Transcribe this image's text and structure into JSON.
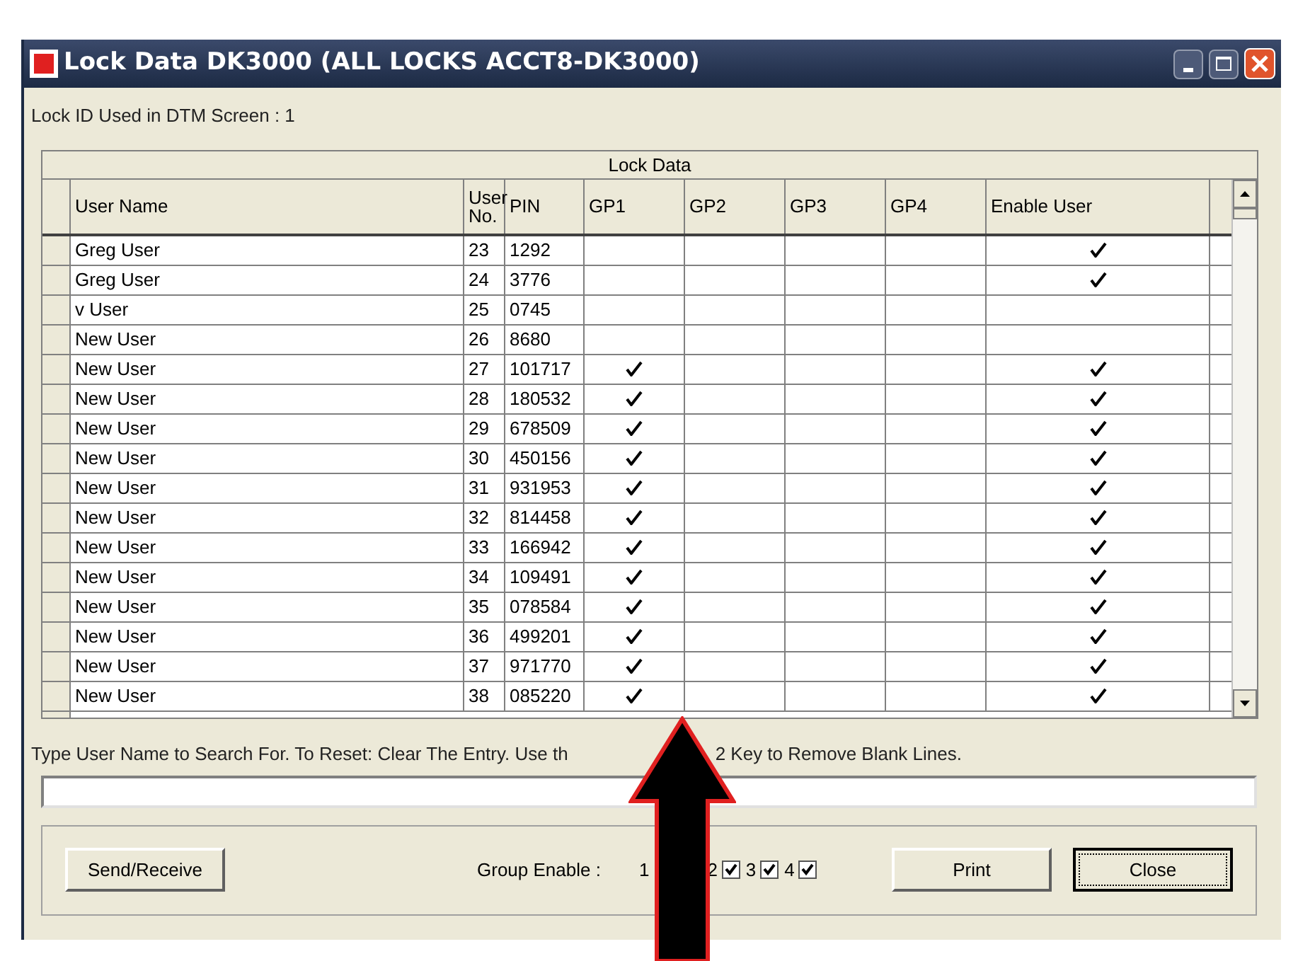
{
  "window": {
    "title": "Lock Data DK3000 (ALL LOCKS ACCT8-DK3000)"
  },
  "lock_id_label": "Lock ID Used in DTM Screen : 1",
  "grid": {
    "caption": "Lock Data",
    "columns": [
      "User Name",
      "User No.",
      "PIN",
      "GP1",
      "GP2",
      "GP3",
      "GP4",
      "Enable User"
    ],
    "rows": [
      {
        "name": "Greg User",
        "no": "23",
        "pin": "1292",
        "gp1": false,
        "gp2": false,
        "gp3": false,
        "gp4": false,
        "enabled": true
      },
      {
        "name": "Greg User",
        "no": "24",
        "pin": "3776",
        "gp1": false,
        "gp2": false,
        "gp3": false,
        "gp4": false,
        "enabled": true
      },
      {
        "name": "v User",
        "no": "25",
        "pin": "0745",
        "gp1": false,
        "gp2": false,
        "gp3": false,
        "gp4": false,
        "enabled": false
      },
      {
        "name": "New User",
        "no": "26",
        "pin": "8680",
        "gp1": false,
        "gp2": false,
        "gp3": false,
        "gp4": false,
        "enabled": false
      },
      {
        "name": "New User",
        "no": "27",
        "pin": "101717",
        "gp1": true,
        "gp2": false,
        "gp3": false,
        "gp4": false,
        "enabled": true
      },
      {
        "name": "New User",
        "no": "28",
        "pin": "180532",
        "gp1": true,
        "gp2": false,
        "gp3": false,
        "gp4": false,
        "enabled": true
      },
      {
        "name": "New User",
        "no": "29",
        "pin": "678509",
        "gp1": true,
        "gp2": false,
        "gp3": false,
        "gp4": false,
        "enabled": true
      },
      {
        "name": "New User",
        "no": "30",
        "pin": "450156",
        "gp1": true,
        "gp2": false,
        "gp3": false,
        "gp4": false,
        "enabled": true
      },
      {
        "name": "New User",
        "no": "31",
        "pin": "931953",
        "gp1": true,
        "gp2": false,
        "gp3": false,
        "gp4": false,
        "enabled": true
      },
      {
        "name": "New User",
        "no": "32",
        "pin": "814458",
        "gp1": true,
        "gp2": false,
        "gp3": false,
        "gp4": false,
        "enabled": true
      },
      {
        "name": "New User",
        "no": "33",
        "pin": "166942",
        "gp1": true,
        "gp2": false,
        "gp3": false,
        "gp4": false,
        "enabled": true
      },
      {
        "name": "New User",
        "no": "34",
        "pin": "109491",
        "gp1": true,
        "gp2": false,
        "gp3": false,
        "gp4": false,
        "enabled": true
      },
      {
        "name": "New User",
        "no": "35",
        "pin": "078584",
        "gp1": true,
        "gp2": false,
        "gp3": false,
        "gp4": false,
        "enabled": true
      },
      {
        "name": "New User",
        "no": "36",
        "pin": "499201",
        "gp1": true,
        "gp2": false,
        "gp3": false,
        "gp4": false,
        "enabled": true
      },
      {
        "name": "New User",
        "no": "37",
        "pin": "971770",
        "gp1": true,
        "gp2": false,
        "gp3": false,
        "gp4": false,
        "enabled": true
      },
      {
        "name": "New User",
        "no": "38",
        "pin": "085220",
        "gp1": true,
        "gp2": false,
        "gp3": false,
        "gp4": false,
        "enabled": true
      }
    ]
  },
  "hint_before_arrow": "Type User Name to Search For. To Reset: Clear The Entry. Use th",
  "hint_after_arrow": "2 Key to Remove Blank Lines.",
  "send_receive_button": "Send/Receive",
  "group_enable": {
    "label": "Group Enable :",
    "groups": [
      {
        "number": "1"
      },
      {
        "number": "2",
        "checked": true
      },
      {
        "number": "3",
        "checked": true
      },
      {
        "number": "4",
        "checked": true
      }
    ]
  },
  "print_button": "Print",
  "close_button": "Close"
}
